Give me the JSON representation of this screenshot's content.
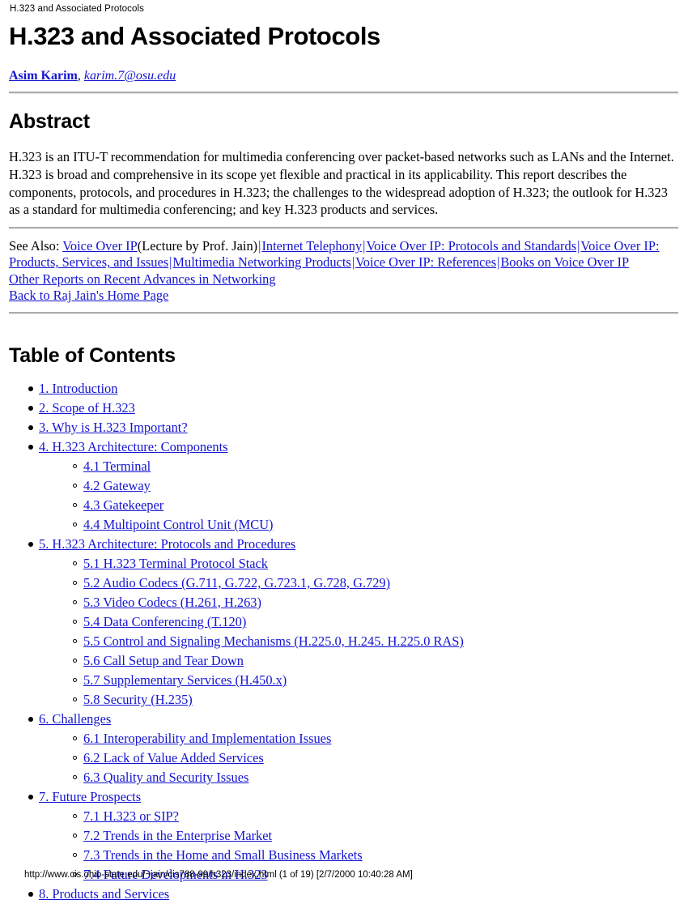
{
  "running_head": "H.323 and Associated Protocols",
  "title": "H.323 and Associated Protocols",
  "byline": {
    "author": "Asim Karim",
    "comma": ",",
    "email": "karim.7@osu.edu"
  },
  "abstract": {
    "heading": "Abstract",
    "body": "H.323 is an ITU-T recommendation for multimedia conferencing over packet-based networks such as LANs and the Internet. H.323 is broad and comprehensive in its scope yet flexible and practical in its applicability. This report describes the components, protocols, and procedures in H.323; the challenges to the widespread adoption of H.323; the outlook for H.323 as a standard for multimedia conferencing; and key H.323 products and services."
  },
  "see_also": {
    "label": "See Also:",
    "separator": "|",
    "links": [
      "Voice Over IP",
      "Internet Telephony",
      "Voice Over IP: Protocols and Standards",
      "Voice Over IP: Products, Services, and Issues",
      "Multimedia Networking Products",
      "Voice Over IP: References",
      "Books on Voice Over IP"
    ],
    "note_after_first": "(Lecture by Prof. Jain)"
  },
  "nav_links": [
    "Other Reports on Recent Advances in Networking",
    "Back to Raj Jain's Home Page"
  ],
  "toc": {
    "heading": "Table of Contents",
    "items": [
      {
        "label": "1. Introduction",
        "children": []
      },
      {
        "label": "2. Scope of H.323",
        "children": []
      },
      {
        "label": "3. Why is H.323 Important?",
        "children": []
      },
      {
        "label": "4. H.323 Architecture: Components",
        "children": [
          "4.1 Terminal",
          "4.2 Gateway",
          "4.3 Gatekeeper",
          "4.4 Multipoint Control Unit (MCU)"
        ]
      },
      {
        "label": "5. H.323 Architecture: Protocols and Procedures",
        "children": [
          "5.1 H.323 Terminal Protocol Stack",
          "5.2 Audio Codecs (G.711, G.722, G.723.1, G.728, G.729)",
          "5.3 Video Codecs (H.261, H.263)",
          "5.4 Data Conferencing (T.120)",
          "5.5 Control and Signaling Mechanisms (H.225.0, H.245. H.225.0 RAS)",
          "5.6 Call Setup and Tear Down",
          "5.7 Supplementary Services (H.450.x)",
          "5.8 Security (H.235)"
        ]
      },
      {
        "label": "6. Challenges",
        "children": [
          "6.1 Interoperability and Implementation Issues",
          "6.2 Lack of Value Added Services",
          "6.3 Quality and Security Issues"
        ]
      },
      {
        "label": "7. Future Prospects",
        "children": [
          "7.1 H.323 or SIP?",
          "7.2 Trends in the Enterprise Market",
          "7.3 Trends in the Home and Small Business Markets",
          "7.4 Future Developments in H.323"
        ]
      },
      {
        "label": "8. Products and Services",
        "children": []
      }
    ]
  },
  "footer": "http://www.cis.ohio-state.edu/~jain/cis788-99/h323/index.html (1 of 19) [2/7/2000 10:40:28 AM]",
  "colors": {
    "link": "#1414d2",
    "text": "#000000",
    "rule": "#adadad",
    "background": "#ffffff"
  }
}
